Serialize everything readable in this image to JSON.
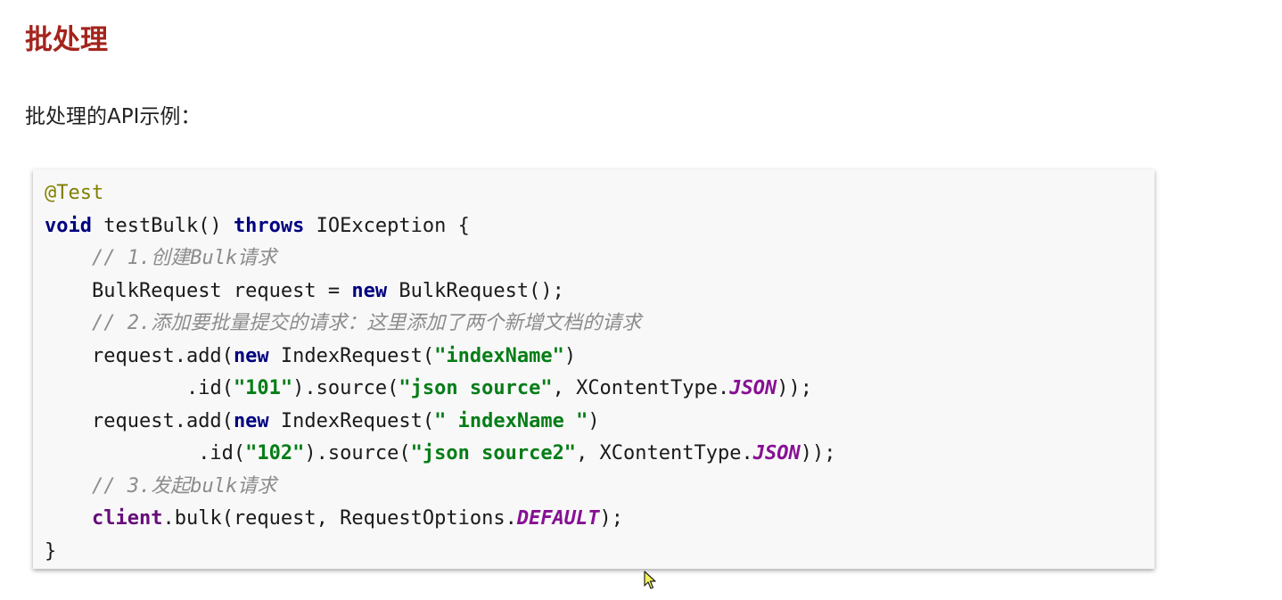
{
  "title": "批处理",
  "intro": "批处理的API示例：",
  "code": {
    "l1_annotation": "@Test",
    "l2_kw_void": "void",
    "l2_method": " testBulk() ",
    "l2_kw_throws": "throws",
    "l2_rest": " IOException {",
    "l3_comment": "// 1.创建Bulk请求",
    "l4_pre": "BulkRequest request = ",
    "l4_kw_new": "new",
    "l4_post": " BulkRequest();",
    "l5_comment": "// 2.添加要批量提交的请求：这里添加了两个新增文档的请求",
    "l6_pre": "request.add(",
    "l6_kw_new": "new",
    "l6_mid": " IndexRequest(",
    "l6_str": "\"indexName\"",
    "l6_post": ")",
    "l7_pre": ".id(",
    "l7_str_id": "\"101\"",
    "l7_mid": ").source(",
    "l7_str_src": "\"json source\"",
    "l7_mid2": ", XContentType.",
    "l7_const": "JSON",
    "l7_post": "));",
    "l8_pre": "request.add(",
    "l8_kw_new": "new",
    "l8_mid": " IndexRequest(",
    "l8_str": "\" indexName \"",
    "l8_post": ")",
    "l9_pre": ".id(",
    "l9_str_id": "\"102\"",
    "l9_mid": ").source(",
    "l9_str_src": "\"json source2\"",
    "l9_mid2": ", XContentType.",
    "l9_const": "JSON",
    "l9_post": "));",
    "l10_comment": "// 3.发起bulk请求",
    "l11_field": "client",
    "l11_mid": ".bulk(request, RequestOptions.",
    "l11_const": "DEFAULT",
    "l11_post": ");",
    "l12_close": "}"
  }
}
